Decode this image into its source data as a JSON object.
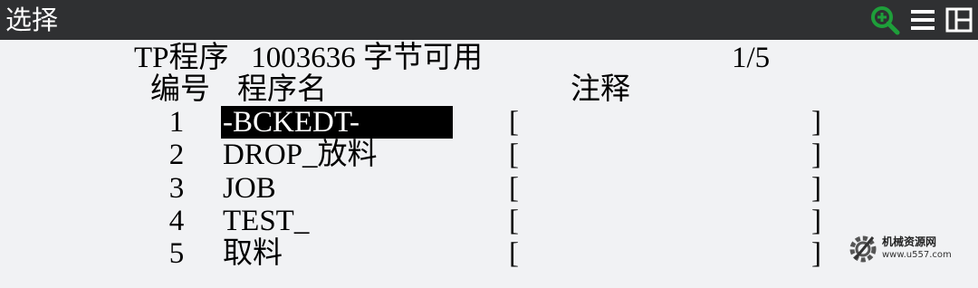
{
  "window": {
    "title": "选择"
  },
  "toolbar": {
    "icons": [
      "zoom-in-icon",
      "menu-icon",
      "split-view-icon"
    ],
    "accent": "#1e9e3a"
  },
  "header": {
    "type_label": "TP程序",
    "bytes_value": "1003636",
    "bytes_label": "字节可用",
    "page_indicator": "1/5"
  },
  "columns": {
    "number": "编号",
    "name": "程序名",
    "comment": "注释"
  },
  "programs": [
    {
      "number": "1",
      "name": "-BCKEDT-",
      "comment": "",
      "selected": true
    },
    {
      "number": "2",
      "name": "DROP_放料",
      "comment": "",
      "selected": false
    },
    {
      "number": "3",
      "name": "JOB",
      "comment": "",
      "selected": false
    },
    {
      "number": "4",
      "name": "TEST_",
      "comment": "",
      "selected": false
    },
    {
      "number": "5",
      "name": "取料",
      "comment": "",
      "selected": false
    }
  ],
  "brackets": {
    "left": "[",
    "right": "]"
  },
  "watermark": {
    "name": "机械资源网",
    "url": "www.u557.com"
  }
}
